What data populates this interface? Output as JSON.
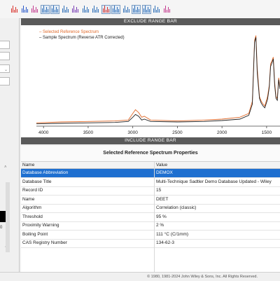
{
  "colors": {
    "reference": "#e06a2b",
    "sample": "#222222",
    "selection": "#1e6fd0",
    "range_bar": "#5a5a5a"
  },
  "toolbar": {
    "buttons": [
      {
        "name": "spectrum-red-icon",
        "color": "#d9302a",
        "boxed": false
      },
      {
        "name": "spectrum-blue-icon",
        "color": "#2a59c9",
        "boxed": false
      },
      {
        "name": "spectrum-multi-icon",
        "color": "#c43b8f",
        "boxed": false
      },
      {
        "name": "spectrum-stack-icon",
        "color": "#2f6fb8",
        "boxed": true
      },
      {
        "name": "spectrum-overlay-icon",
        "color": "#2f6fb8",
        "boxed": true
      },
      {
        "name": "spectrum-compare-icon",
        "color": "#2f6fb8",
        "boxed": false
      },
      {
        "name": "spectrum-purple-icon",
        "color": "#7a3fb5",
        "boxed": false
      },
      {
        "name": "spectrum-offset-icon",
        "color": "#2f6fb8",
        "boxed": false
      },
      {
        "name": "spectrum-zoom-icon",
        "color": "#2f6fb8",
        "boxed": false
      },
      {
        "name": "spectrum-peak-icon",
        "color": "#d9302a",
        "boxed": true
      },
      {
        "name": "spectrum-grid-icon",
        "color": "#2f6fb8",
        "boxed": true
      },
      {
        "name": "spectrum-fit-icon",
        "color": "#2f6fb8",
        "boxed": false
      },
      {
        "name": "spectrum-select-icon",
        "color": "#2f6fb8",
        "boxed": true
      },
      {
        "name": "spectrum-normalize-icon",
        "color": "#2f6fb8",
        "boxed": true
      },
      {
        "name": "spectrum-baseline-icon",
        "color": "#2f6fb8",
        "boxed": false
      },
      {
        "name": "spectrum-mixed-icon",
        "color": "#c43b8f",
        "boxed": false
      }
    ]
  },
  "left_panel": {
    "number": "0"
  },
  "chart": {
    "exclude_label": "EXCLUDE RANGE BAR",
    "include_label": "INCLUDE RANGE BAR",
    "legend_reference": "Selected Reference Spectrum",
    "legend_sample": "Sample Spectrum (Reverse ATR Corrected)",
    "xlabel": "cm⁻¹",
    "x_ticks": [
      "4000",
      "3500",
      "3000",
      "2500",
      "2000",
      "1500"
    ]
  },
  "chart_data": {
    "type": "line",
    "xlabel": "cm⁻¹",
    "xlim": [
      4080,
      1350
    ],
    "x_ticks": [
      4000,
      3500,
      3000,
      2500,
      2000,
      1500
    ],
    "ylim": [
      0,
      1
    ],
    "grid": false,
    "legend": "top-left",
    "series": [
      {
        "name": "Selected Reference Spectrum",
        "points": [
          [
            4080,
            0.02
          ],
          [
            3800,
            0.03
          ],
          [
            3500,
            0.035
          ],
          [
            3200,
            0.04
          ],
          [
            3050,
            0.05
          ],
          [
            3000,
            0.12
          ],
          [
            2970,
            0.16
          ],
          [
            2935,
            0.13
          ],
          [
            2900,
            0.08
          ],
          [
            2870,
            0.09
          ],
          [
            2800,
            0.05
          ],
          [
            2500,
            0.04
          ],
          [
            2200,
            0.05
          ],
          [
            2000,
            0.06
          ],
          [
            1800,
            0.08
          ],
          [
            1700,
            0.12
          ],
          [
            1660,
            0.25
          ],
          [
            1635,
            0.9
          ],
          [
            1620,
            0.95
          ],
          [
            1605,
            0.6
          ],
          [
            1580,
            0.3
          ],
          [
            1560,
            0.25
          ],
          [
            1540,
            0.22
          ],
          [
            1520,
            0.2
          ],
          [
            1490,
            0.3
          ],
          [
            1470,
            0.42
          ],
          [
            1455,
            0.65
          ],
          [
            1440,
            0.68
          ],
          [
            1425,
            0.72
          ],
          [
            1410,
            0.45
          ],
          [
            1395,
            0.3
          ],
          [
            1380,
            0.28
          ],
          [
            1365,
            0.5
          ],
          [
            1350,
            0.4
          ]
        ]
      },
      {
        "name": "Sample Spectrum (Reverse ATR Corrected)",
        "points": [
          [
            4080,
            0.01
          ],
          [
            3800,
            0.015
          ],
          [
            3500,
            0.02
          ],
          [
            3200,
            0.025
          ],
          [
            3050,
            0.035
          ],
          [
            3000,
            0.08
          ],
          [
            2970,
            0.11
          ],
          [
            2935,
            0.09
          ],
          [
            2900,
            0.05
          ],
          [
            2870,
            0.06
          ],
          [
            2800,
            0.035
          ],
          [
            2500,
            0.03
          ],
          [
            2200,
            0.035
          ],
          [
            2000,
            0.045
          ],
          [
            1800,
            0.06
          ],
          [
            1700,
            0.1
          ],
          [
            1660,
            0.22
          ],
          [
            1635,
            0.88
          ],
          [
            1620,
            0.93
          ],
          [
            1605,
            0.55
          ],
          [
            1580,
            0.28
          ],
          [
            1560,
            0.23
          ],
          [
            1540,
            0.2
          ],
          [
            1520,
            0.18
          ],
          [
            1490,
            0.27
          ],
          [
            1470,
            0.4
          ],
          [
            1455,
            0.62
          ],
          [
            1440,
            0.66
          ],
          [
            1425,
            0.7
          ],
          [
            1410,
            0.42
          ],
          [
            1395,
            0.28
          ],
          [
            1380,
            0.26
          ],
          [
            1365,
            0.48
          ],
          [
            1350,
            0.38
          ]
        ]
      }
    ]
  },
  "properties": {
    "title": "Selected Reference Spectrum Properties",
    "col_name": "Name",
    "col_value": "Value",
    "rows": [
      {
        "name": "Database Abbreviation",
        "value": "DEMOX",
        "selected": true
      },
      {
        "name": "Database Title",
        "value": "Multi-Technique Sadtler Demo Database Updated - Wiley",
        "selected": false
      },
      {
        "name": "Record ID",
        "value": "15",
        "selected": false
      },
      {
        "name": "Name",
        "value": "DEET",
        "selected": false
      },
      {
        "name": "Algorithm",
        "value": "Correlation (classic)",
        "selected": false
      },
      {
        "name": "Threshold",
        "value": "95 %",
        "selected": false
      },
      {
        "name": "Proximity Warning",
        "value": "2 %",
        "selected": false
      },
      {
        "name": "Boiling Point",
        "value": "111 °C (C/1mm)",
        "selected": false
      },
      {
        "name": "CAS Registry Number",
        "value": "134-62-3",
        "selected": false
      }
    ]
  },
  "status": {
    "copyright": "© 1980, 1981-2024 John Wiley & Sons, Inc. All Rights Reserved."
  }
}
